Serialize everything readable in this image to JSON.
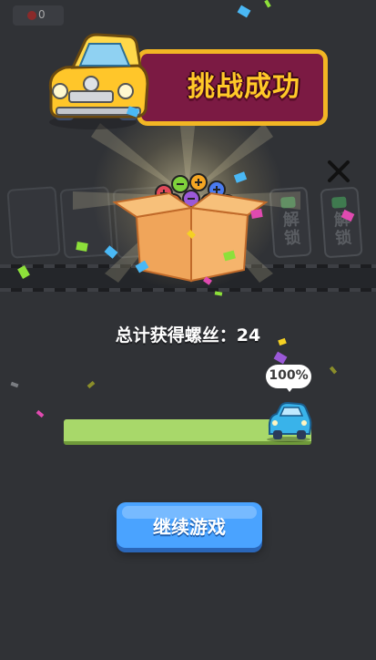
{
  "hud": {
    "coin_count": "0",
    "coin_icon": "screw-coin-icon"
  },
  "banner": {
    "title": "挑战成功"
  },
  "slots": {
    "unlock_label": "解锁",
    "unlock_icon": "video-icon"
  },
  "reward": {
    "total_text": "总计获得螺丝：24"
  },
  "progress": {
    "percent_label": "100%",
    "fraction": 1.0
  },
  "buttons": {
    "continue_label": "继续游戏"
  },
  "colors": {
    "background": "#303236",
    "banner_red": "#7b1a43",
    "banner_gold": "#f2b624",
    "button_blue": "#4aa3ff",
    "progress_green": "#a8d86a"
  }
}
